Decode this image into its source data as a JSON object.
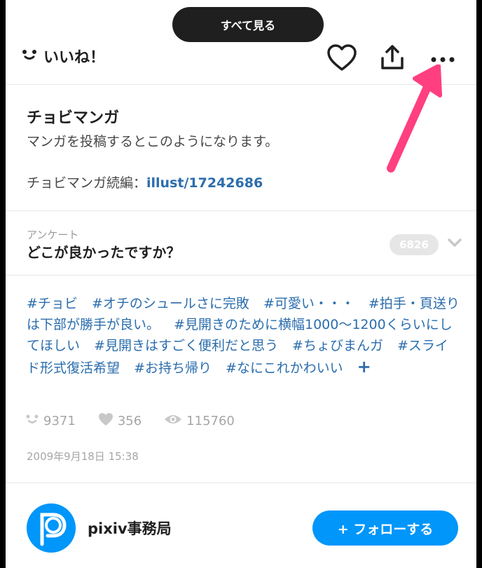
{
  "header": {
    "see_all": "すべて見る",
    "like_label": "いいね！"
  },
  "work": {
    "title": "チョビマンガ",
    "description": "マンガを投稿するとこのようになります。",
    "sequel_prefix": "チョビマンガ続編：",
    "sequel_link": "illust/17242686"
  },
  "survey": {
    "label": "アンケート",
    "question": "どこが良かったですか？",
    "count": "6826"
  },
  "tags": [
    "#チョビ",
    "#オチのシュールさに完敗",
    "#可愛い・・・",
    "#拍手・頁送りは下部が勝手が良い。",
    "#見開きのために横幅1000〜1200くらいにしてほしい",
    "#見開きはすごく便利だと思う",
    "#ちょびまんガ",
    "#スライド形式復活希望",
    "#お持ち帰り",
    "#なにこれかわいい"
  ],
  "tags_more": "+",
  "stats": {
    "likes": "9371",
    "bookmarks": "356",
    "views": "115760"
  },
  "date": "2009年9月18日 15:38",
  "author": {
    "name": "pixiv事務局",
    "follow_label": "+ フォローする"
  },
  "colors": {
    "accent": "#0096fa",
    "link": "#2b6dad",
    "annotation_arrow": "#ff3f7f"
  }
}
